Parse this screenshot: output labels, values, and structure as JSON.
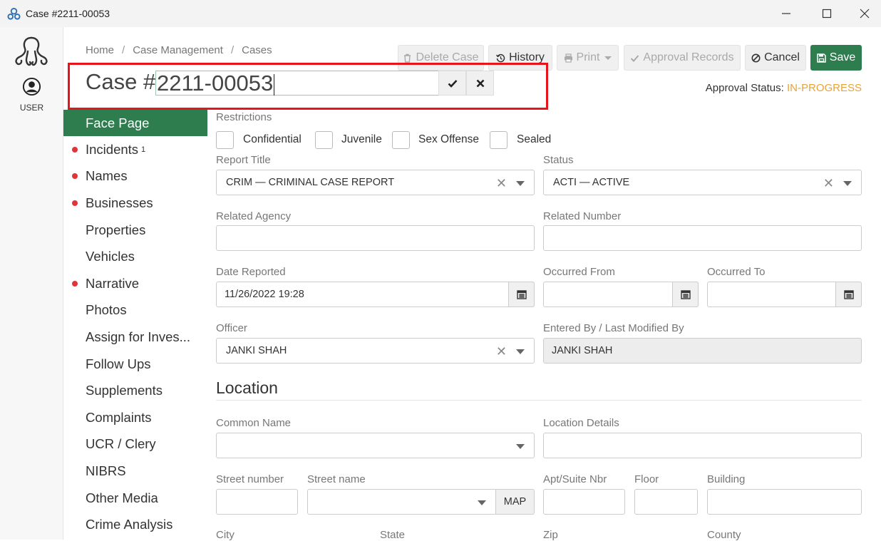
{
  "window": {
    "title": "Case #2211-00053"
  },
  "rail": {
    "user_label": "USER"
  },
  "breadcrumb": {
    "items": [
      "Home",
      "Case Management",
      "Cases"
    ]
  },
  "toolbar": {
    "delete_label": "Delete Case",
    "history_label": "History",
    "print_label": "Print",
    "approval_label": "Approval Records",
    "cancel_label": "Cancel",
    "save_label": "Save"
  },
  "case": {
    "prefix": "Case #",
    "number": "2211-00053"
  },
  "approval": {
    "label": "Approval Status:",
    "value": "IN-PROGRESS"
  },
  "nav": {
    "items": [
      {
        "label": "Face Page",
        "active": true,
        "dot": false
      },
      {
        "label": "Incidents",
        "sup": "1",
        "dot": true
      },
      {
        "label": "Names",
        "dot": true
      },
      {
        "label": "Businesses",
        "dot": true
      },
      {
        "label": "Properties",
        "dot": false
      },
      {
        "label": "Vehicles",
        "dot": false
      },
      {
        "label": "Narrative",
        "dot": true
      },
      {
        "label": "Photos",
        "dot": false
      },
      {
        "label": "Assign for Inves...",
        "dot": false
      },
      {
        "label": "Follow Ups",
        "dot": false
      },
      {
        "label": "Supplements",
        "dot": false
      },
      {
        "label": "Complaints",
        "dot": false
      },
      {
        "label": "UCR / Clery",
        "dot": false
      },
      {
        "label": "NIBRS",
        "dot": false
      },
      {
        "label": "Other Media",
        "dot": false
      },
      {
        "label": "Crime Analysis",
        "dot": false
      }
    ]
  },
  "form": {
    "restrictions_label": "Restrictions",
    "restrictions": [
      "Confidential",
      "Juvenile",
      "Sex Offense",
      "Sealed"
    ],
    "report_title": {
      "label": "Report Title",
      "value": "CRIM — CRIMINAL CASE REPORT"
    },
    "status": {
      "label": "Status",
      "value": "ACTI — ACTIVE"
    },
    "related_agency": {
      "label": "Related Agency",
      "value": ""
    },
    "related_number": {
      "label": "Related Number",
      "value": ""
    },
    "date_reported": {
      "label": "Date Reported",
      "value": "11/26/2022 19:28"
    },
    "occurred_from": {
      "label": "Occurred From",
      "value": ""
    },
    "occurred_to": {
      "label": "Occurred To",
      "value": ""
    },
    "officer": {
      "label": "Officer",
      "value": "JANKI SHAH"
    },
    "entered_by": {
      "label": "Entered By / Last Modified By",
      "value": "JANKI SHAH"
    }
  },
  "location": {
    "title": "Location",
    "common_name": {
      "label": "Common Name",
      "value": ""
    },
    "location_details": {
      "label": "Location Details",
      "value": ""
    },
    "street_number": {
      "label": "Street number"
    },
    "street_name": {
      "label": "Street name"
    },
    "map_label": "MAP",
    "apt": {
      "label": "Apt/Suite Nbr"
    },
    "floor": {
      "label": "Floor"
    },
    "building": {
      "label": "Building"
    },
    "city": {
      "label": "City"
    },
    "state": {
      "label": "State"
    },
    "zip": {
      "label": "Zip"
    },
    "county": {
      "label": "County"
    }
  },
  "colors": {
    "accent": "#2e7d4f",
    "highlight": "#e8141b",
    "status": "#e8a33a",
    "dot": "#e0343a"
  }
}
